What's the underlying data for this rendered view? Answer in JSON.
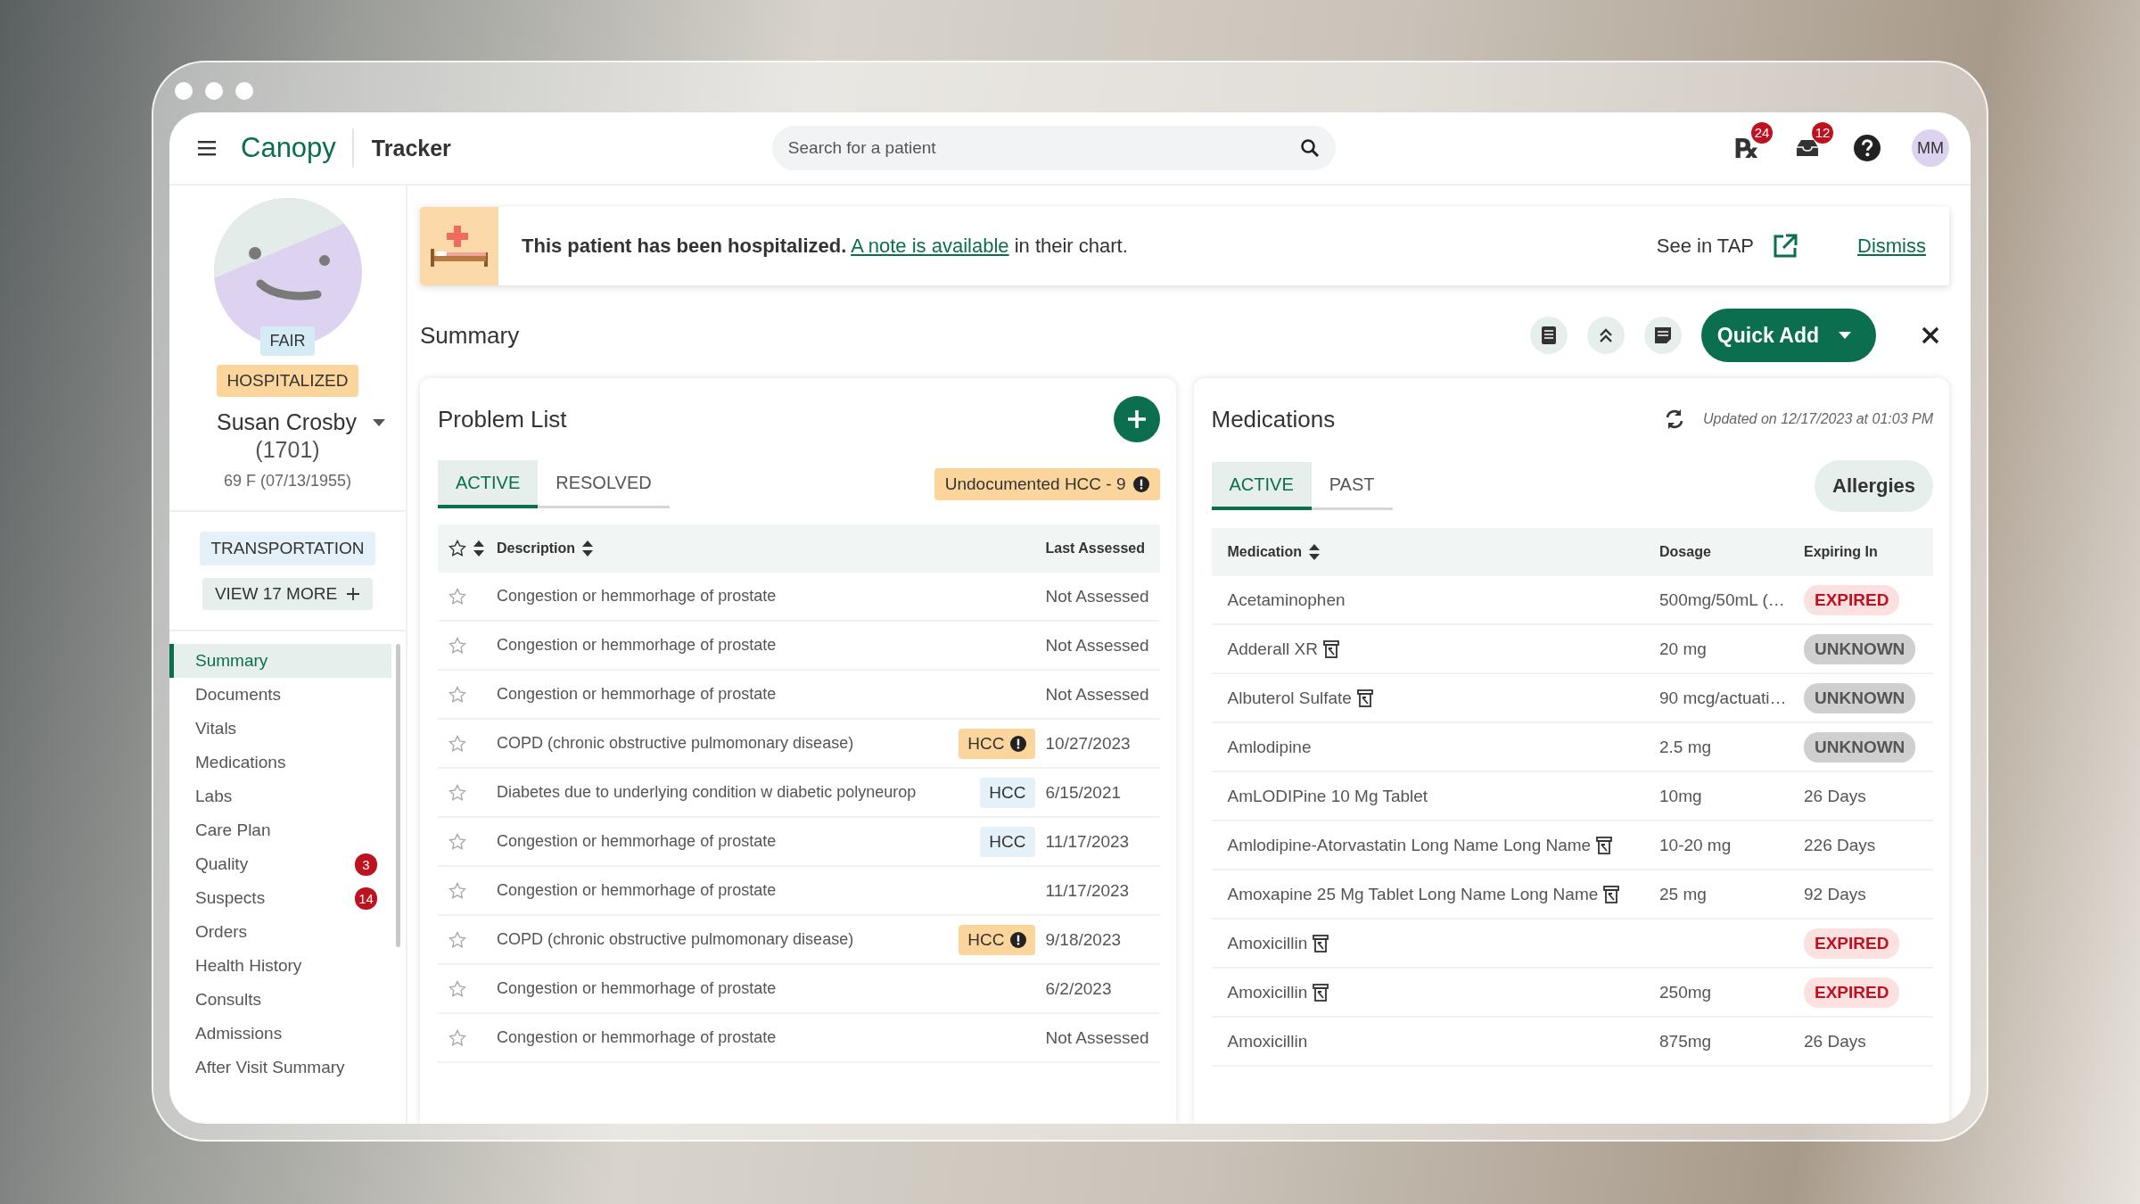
{
  "header": {
    "app_name": "Canopy",
    "section": "Tracker",
    "search": {
      "placeholder": "Search for a patient"
    },
    "notifications": [
      {
        "kind": "rx",
        "glyph": "℞",
        "count": "24"
      },
      {
        "kind": "inbox",
        "count": "12"
      }
    ],
    "user_initials": "MM"
  },
  "patient": {
    "status": "FAIR",
    "alert": "HOSPITALIZED",
    "name": "Susan Crosby",
    "id": "(1701)",
    "details": "69 F (07/13/1955)",
    "tags": [
      "TRANSPORTATION"
    ],
    "more_button": "VIEW 17 MORE"
  },
  "sidebar": {
    "items": [
      {
        "label": "Summary",
        "selected": true
      },
      {
        "label": "Documents",
        "selected": false
      },
      {
        "label": "Vitals",
        "selected": false
      },
      {
        "label": "Medications",
        "selected": false
      },
      {
        "label": "Labs",
        "selected": false
      },
      {
        "label": "Care Plan",
        "selected": false
      },
      {
        "label": "Quality",
        "selected": false,
        "badge": "3"
      },
      {
        "label": "Suspects",
        "selected": false,
        "badge": "14"
      },
      {
        "label": "Orders",
        "selected": false
      },
      {
        "label": "Health History",
        "selected": false
      },
      {
        "label": "Consults",
        "selected": false
      },
      {
        "label": "Admissions",
        "selected": false
      },
      {
        "label": "After Visit Summary",
        "selected": false
      }
    ]
  },
  "banner": {
    "message": "**This patient has been hospitalized.**",
    "link": "A note is available",
    "suffix": "in their chart.",
    "action": "See in TAP",
    "dismiss": "Dismiss"
  },
  "summary": {
    "title": "Summary",
    "quick_add": "Quick Add"
  },
  "problem_list": {
    "title": "Problem List",
    "tabs": [
      {
        "label": "ACTIVE",
        "selected": true
      },
      {
        "label": "RESOLVED",
        "selected": false
      }
    ],
    "alert": "Undocumented HCC - 9",
    "columns": [
      "Description",
      "Last Assessed"
    ],
    "rows": [
      {
        "starred": false,
        "description": "Congestion or hemmorhage of prostate",
        "last_assessed": "Not Assessed"
      },
      {
        "starred": false,
        "description": "Congestion or hemmorhage of prostate",
        "last_assessed": "Not Assessed"
      },
      {
        "starred": false,
        "description": "Congestion or hemmorhage of prostate",
        "last_assessed": "Not Assessed"
      },
      {
        "starred": false,
        "description": "COPD (chronic obstructive pulmomonary disease)",
        "hcc": {
          "label": "HCC",
          "kind": "warning"
        },
        "last_assessed": "10/27/2023"
      },
      {
        "starred": false,
        "description": "Diabetes due to underlying condition w diabetic polyneurop",
        "hcc": {
          "label": "HCC",
          "kind": "info"
        },
        "last_assessed": "6/15/2021"
      },
      {
        "starred": false,
        "description": "Congestion or hemmorhage of prostate",
        "hcc": {
          "label": "HCC",
          "kind": "info"
        },
        "last_assessed": "11/17/2023"
      },
      {
        "starred": false,
        "description": "Congestion or hemmorhage of prostate",
        "last_assessed": "11/17/2023"
      },
      {
        "starred": false,
        "description": "COPD (chronic obstructive pulmomonary disease)",
        "hcc": {
          "label": "HCC",
          "kind": "warning"
        },
        "last_assessed": "9/18/2023"
      },
      {
        "starred": false,
        "description": "Congestion or hemmorhage of prostate",
        "last_assessed": "6/2/2023"
      },
      {
        "starred": false,
        "description": "Congestion or hemmorhage of prostate",
        "last_assessed": "Not Assessed"
      }
    ]
  },
  "medications": {
    "title": "Medications",
    "updated": "Updated on 12/17/2023 at 01:03 PM",
    "tabs": [
      {
        "label": "ACTIVE",
        "selected": true
      },
      {
        "label": "PAST",
        "selected": false
      }
    ],
    "allergies": "Allergies",
    "columns": [
      "Medication",
      "Dosage",
      "Expiring In"
    ],
    "rows": [
      {
        "name": "Acetaminophen",
        "rx_flag": false,
        "dosage": "500mg/50mL (…",
        "expiry": {
          "kind": "expired",
          "text": "EXPIRED"
        }
      },
      {
        "name": "Adderall XR",
        "rx_flag": true,
        "dosage": "20 mg",
        "expiry": {
          "kind": "unknown",
          "text": "UNKNOWN"
        }
      },
      {
        "name": "Albuterol Sulfate",
        "rx_flag": true,
        "dosage": "90 mcg/actuati…",
        "expiry": {
          "kind": "unknown",
          "text": "UNKNOWN"
        }
      },
      {
        "name": "Amlodipine",
        "rx_flag": false,
        "dosage": "2.5 mg",
        "expiry": {
          "kind": "unknown",
          "text": "UNKNOWN"
        }
      },
      {
        "name": "AmLODIPine 10 Mg Tablet",
        "rx_flag": false,
        "dosage": "10mg",
        "expiry": {
          "kind": "days",
          "text": "26 Days"
        }
      },
      {
        "name": "Amlodipine-Atorvastatin Long Name Long Name",
        "rx_flag": true,
        "dosage": "10-20 mg",
        "expiry": {
          "kind": "days",
          "text": "226 Days"
        }
      },
      {
        "name": "Amoxapine 25 Mg Tablet Long Name Long Name",
        "rx_flag": true,
        "dosage": "25 mg",
        "expiry": {
          "kind": "days",
          "text": "92 Days"
        }
      },
      {
        "name": "Amoxicillin",
        "rx_flag": true,
        "expiry": {
          "kind": "expired",
          "text": "EXPIRED"
        }
      },
      {
        "name": "Amoxicillin",
        "rx_flag": true,
        "dosage": "250mg",
        "expiry": {
          "kind": "expired",
          "text": "EXPIRED"
        }
      },
      {
        "name": "Amoxicillin",
        "rx_flag": false,
        "dosage": "875mg",
        "expiry": {
          "kind": "days",
          "text": "26 Days"
        }
      }
    ]
  }
}
